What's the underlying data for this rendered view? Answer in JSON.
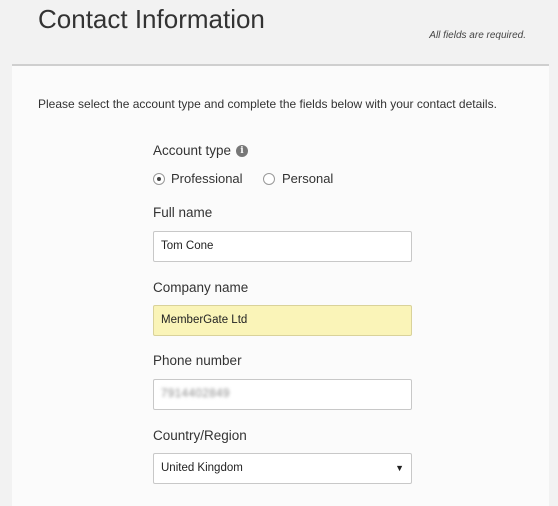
{
  "header": {
    "title": "Contact Information",
    "required_note": "All fields are required."
  },
  "intro": "Please select the account type and complete the fields below with your contact details.",
  "account_type": {
    "label": "Account type",
    "info_icon": "info-icon",
    "options": [
      {
        "label": "Professional",
        "selected": true
      },
      {
        "label": "Personal",
        "selected": false
      }
    ]
  },
  "fields": {
    "full_name": {
      "label": "Full name",
      "value": "Tom Cone"
    },
    "company_name": {
      "label": "Company name",
      "value": "MemberGate Ltd",
      "highlight_color": "#faf4b8"
    },
    "phone_number": {
      "label": "Phone number",
      "value": "7914402849"
    },
    "country": {
      "label": "Country/Region",
      "value": "United Kingdom",
      "caret_icon": "caret-down-icon"
    }
  }
}
